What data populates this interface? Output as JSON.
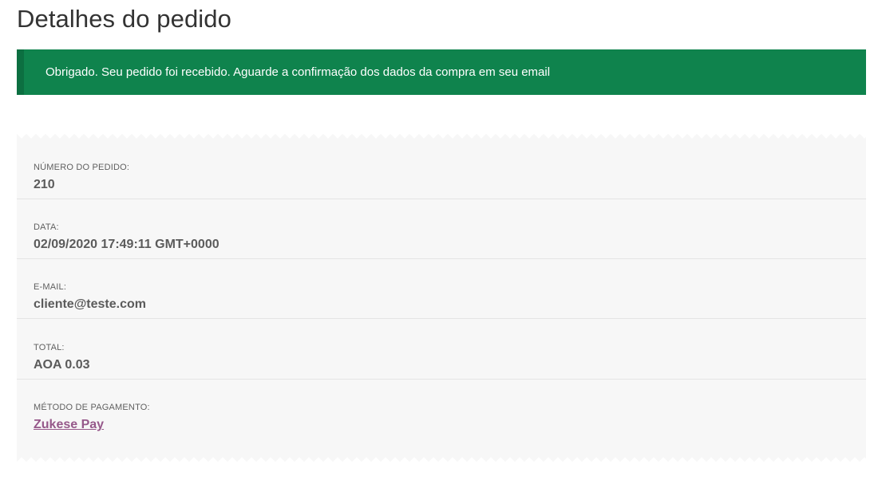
{
  "page": {
    "title": "Detalhes do pedido"
  },
  "notice": {
    "message": "Obrigado. Seu pedido foi recebido. Aguarde a confirmação dos dados da compra em seu email",
    "background_color": "#0f834d"
  },
  "order": {
    "items": [
      {
        "label": "NÚMERO DO PEDIDO:",
        "value": "210"
      },
      {
        "label": "DATA:",
        "value": "02/09/2020 17:49:11 GMT+0000"
      },
      {
        "label": "E-MAIL:",
        "value": "cliente@teste.com"
      },
      {
        "label": "TOTAL:",
        "value": "AOA 0.03"
      },
      {
        "label": "MÉTODO DE PAGAMENTO:",
        "value": "Zukese Pay",
        "link_color": "#96588a"
      }
    ]
  }
}
